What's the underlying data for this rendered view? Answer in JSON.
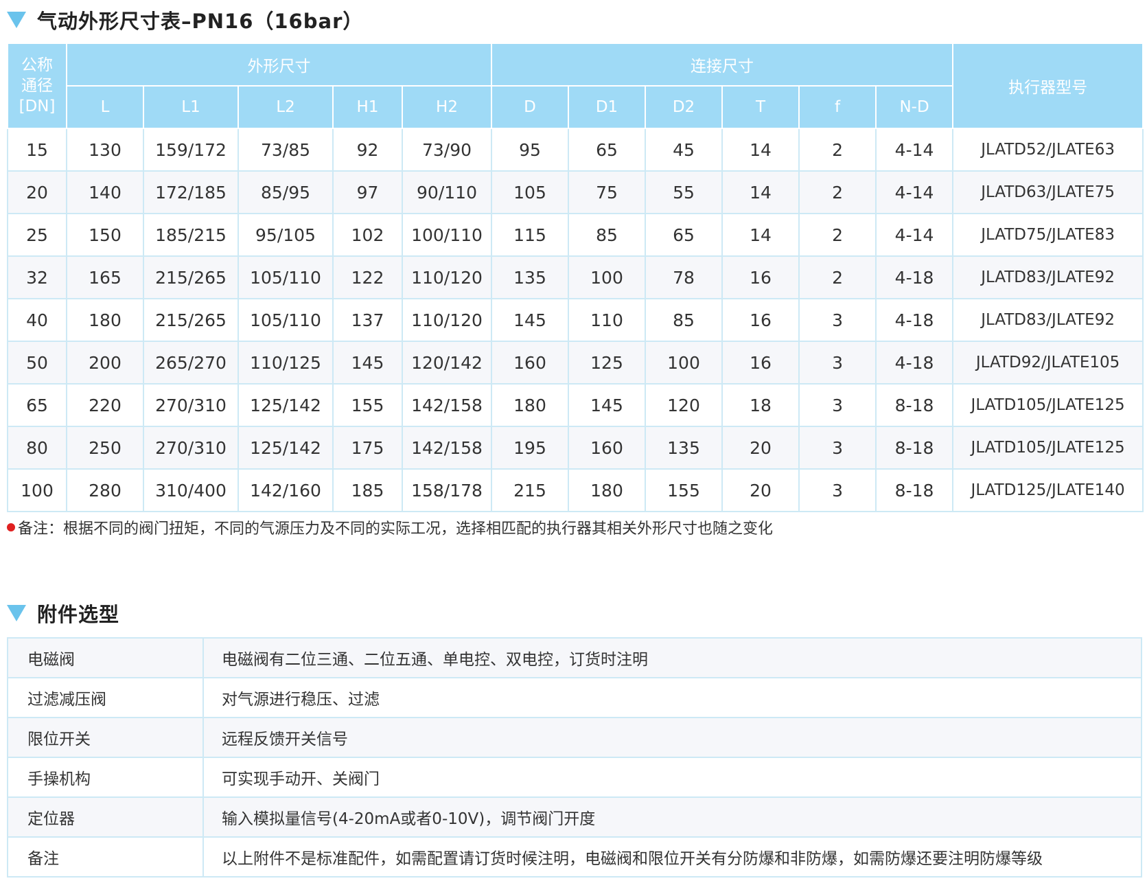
{
  "section1": {
    "title": "气动外形尺寸表–PN16（16bar）"
  },
  "dims_table": {
    "group_headers": {
      "nominal": "公称\n通径\n[DN]",
      "outline": "外形尺寸",
      "connection": "连接尺寸",
      "actuator": "执行器型号"
    },
    "columns": [
      "L",
      "L1",
      "L2",
      "H1",
      "H2",
      "D",
      "D1",
      "D2",
      "T",
      "f",
      "N-D"
    ],
    "rows": [
      [
        "15",
        "130",
        "159/172",
        "73/85",
        "92",
        "73/90",
        "95",
        "65",
        "45",
        "14",
        "2",
        "4-14",
        "JLATD52/JLATE63"
      ],
      [
        "20",
        "140",
        "172/185",
        "85/95",
        "97",
        "90/110",
        "105",
        "75",
        "55",
        "14",
        "2",
        "4-14",
        "JLATD63/JLATE75"
      ],
      [
        "25",
        "150",
        "185/215",
        "95/105",
        "102",
        "100/110",
        "115",
        "85",
        "65",
        "14",
        "2",
        "4-14",
        "JLATD75/JLATE83"
      ],
      [
        "32",
        "165",
        "215/265",
        "105/110",
        "122",
        "110/120",
        "135",
        "100",
        "78",
        "16",
        "2",
        "4-18",
        "JLATD83/JLATE92"
      ],
      [
        "40",
        "180",
        "215/265",
        "105/110",
        "137",
        "110/120",
        "145",
        "110",
        "85",
        "16",
        "3",
        "4-18",
        "JLATD83/JLATE92"
      ],
      [
        "50",
        "200",
        "265/270",
        "110/125",
        "145",
        "120/142",
        "160",
        "125",
        "100",
        "16",
        "3",
        "4-18",
        "JLATD92/JLATE105"
      ],
      [
        "65",
        "220",
        "270/310",
        "125/142",
        "155",
        "142/158",
        "180",
        "145",
        "120",
        "18",
        "3",
        "8-18",
        "JLATD105/JLATE125"
      ],
      [
        "80",
        "250",
        "270/310",
        "125/142",
        "175",
        "142/158",
        "195",
        "160",
        "135",
        "20",
        "3",
        "8-18",
        "JLATD105/JLATE125"
      ],
      [
        "100",
        "280",
        "310/400",
        "142/160",
        "185",
        "158/178",
        "215",
        "180",
        "155",
        "20",
        "3",
        "8-18",
        "JLATD125/JLATE140"
      ]
    ]
  },
  "note": "备注：根据不同的阀门扭矩，不同的气源压力及不同的实际工况，选择相匹配的执行器其相关外形尺寸也随之变化",
  "section2": {
    "title": "附件选型"
  },
  "accessories": [
    {
      "name": "电磁阀",
      "desc": "电磁阀有二位三通、二位五通、单电控、双电控，订货时注明"
    },
    {
      "name": "过滤减压阀",
      "desc": "对气源进行稳压、过滤"
    },
    {
      "name": "限位开关",
      "desc": "远程反馈开关信号"
    },
    {
      "name": "手操机构",
      "desc": "可实现手动开、关阀门"
    },
    {
      "name": "定位器",
      "desc": "输入模拟量信号(4-20mA或者0-10V)，调节阀门开度"
    },
    {
      "name": "备注",
      "desc": "以上附件不是标准配件，如需配置请订货时候注明，电磁阀和限位开关有分防爆和非防爆，如需防爆还要注明防爆等级"
    }
  ],
  "colors": {
    "header_bg": "#9fdaf6",
    "accent_triangle": "#6ac3ec",
    "note_dot": "#e02020",
    "row_alt": "#f6f7fa"
  }
}
